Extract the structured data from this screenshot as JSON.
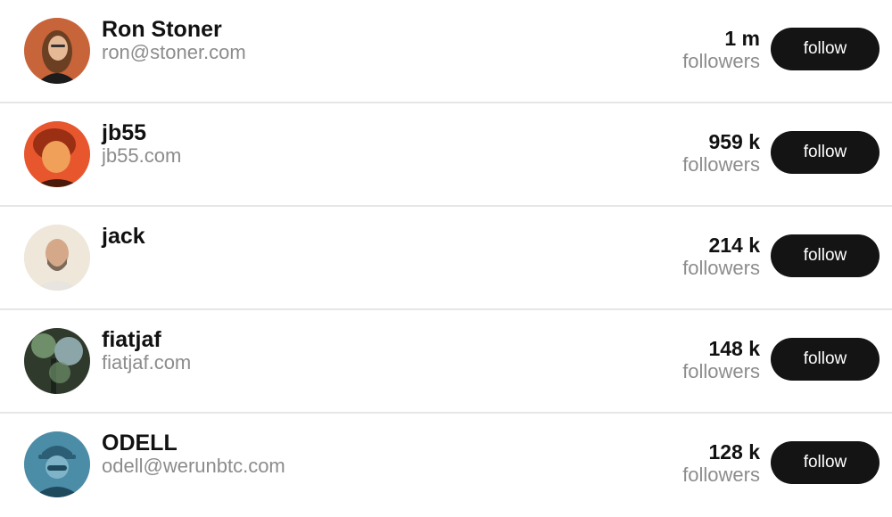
{
  "users": [
    {
      "name": "Ron Stoner",
      "handle": "ron@stoner.com",
      "followers_count": "1 m",
      "followers_label": "followers",
      "button_label": "follow",
      "avatar_colors": {
        "bg": "#c8643a",
        "skin": "#e5b896",
        "hair": "#6b3f22",
        "shirt": "#1c1c1c"
      }
    },
    {
      "name": "jb55",
      "handle": "jb55.com",
      "followers_count": "959 k",
      "followers_label": "followers",
      "button_label": "follow",
      "avatar_colors": {
        "bg": "#e8562e",
        "skin": "#f0a058",
        "hair": "#9a2f14",
        "shirt": "#4a1a0a"
      }
    },
    {
      "name": "jack",
      "handle": "",
      "followers_count": "214 k",
      "followers_label": "followers",
      "button_label": "follow",
      "avatar_colors": {
        "bg": "#efe7da",
        "skin": "#d4a888",
        "hair": "#7a6a5a",
        "shirt": "#e8e4df"
      }
    },
    {
      "name": "fiatjaf",
      "handle": "fiatjaf.com",
      "followers_count": "148 k",
      "followers_label": "followers",
      "button_label": "follow",
      "avatar_colors": {
        "bg": "#2f3a2c",
        "skin": "#6e8f6a",
        "hair": "#8ca5a8",
        "shirt": "#1a241c"
      }
    },
    {
      "name": "ODELL",
      "handle": "odell@werunbtc.com",
      "followers_count": "128 k",
      "followers_label": "followers",
      "button_label": "follow",
      "avatar_colors": {
        "bg": "#4b8ca6",
        "skin": "#7fb4c8",
        "hair": "#2c5f76",
        "shirt": "#1f4a5e"
      }
    }
  ]
}
